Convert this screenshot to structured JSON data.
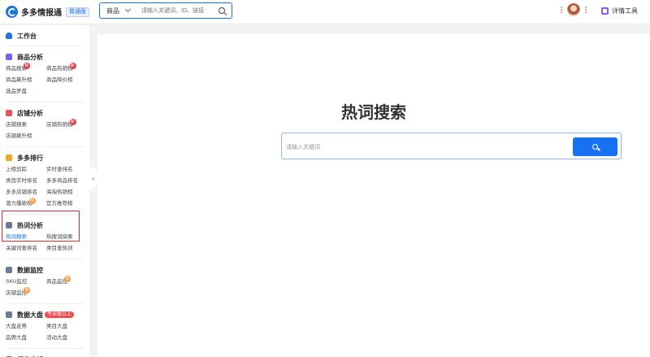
{
  "app": {
    "name": "多多情报通",
    "edition": "普通版"
  },
  "header": {
    "search_category": "商品",
    "search_placeholder": "请输入关键词、ID、链接",
    "tool_label": "详情工具"
  },
  "sidebar": {
    "workbench": "工作台",
    "sections": [
      {
        "title": "商品分析",
        "color": "#7c5cf5",
        "items": [
          {
            "label": "商品搜索",
            "badge": "新",
            "badge_color": "red"
          },
          {
            "label": "商品热销榜",
            "badge": "新",
            "badge_color": "red"
          },
          {
            "label": "商品飙升榜"
          },
          {
            "label": "商品降价榜"
          },
          {
            "label": "选品罗盘"
          }
        ]
      },
      {
        "title": "店铺分析",
        "color": "#f0505a",
        "items": [
          {
            "label": "店铺搜索"
          },
          {
            "label": "店铺热销榜",
            "badge": "新",
            "badge_color": "red"
          },
          {
            "label": "店铺飙升榜"
          }
        ]
      },
      {
        "title": "多多排行",
        "color": "#f5a623",
        "items": [
          {
            "label": "上榜追踪"
          },
          {
            "label": "实时查排名"
          },
          {
            "label": "类目实时排名"
          },
          {
            "label": "多多商品排名"
          },
          {
            "label": "多多店铺排名"
          },
          {
            "label": "海淘热销榜"
          },
          {
            "label": "潜力爆款榜",
            "badge": "热",
            "badge_color": "orange"
          },
          {
            "label": "官方推荐榜"
          }
        ]
      },
      {
        "title": "热词分析",
        "color": "#6b7a99",
        "items": [
          {
            "label": "热词搜索",
            "active": true
          },
          {
            "label": "热搜词探索"
          },
          {
            "label": "关键词查排名"
          },
          {
            "label": "类目查热词"
          }
        ]
      },
      {
        "title": "数据监控",
        "color": "#6b7a99",
        "items": [
          {
            "label": "SKU监控"
          },
          {
            "label": "商品监控",
            "badge": "热",
            "badge_color": "orange"
          },
          {
            "label": "店铺监控",
            "badge": "热",
            "badge_color": "orange"
          }
        ]
      },
      {
        "title": "数据大盘",
        "color": "#6b7a99",
        "tag": "专业版以上",
        "items": [
          {
            "label": "大盘走势"
          },
          {
            "label": "类目大盘"
          },
          {
            "label": "品牌大盘"
          },
          {
            "label": "活动大盘"
          }
        ]
      },
      {
        "title": "行业分析",
        "color": "#6b7a99",
        "items": []
      }
    ]
  },
  "main": {
    "title": "热词搜索",
    "search_placeholder": "请输入关键词"
  }
}
